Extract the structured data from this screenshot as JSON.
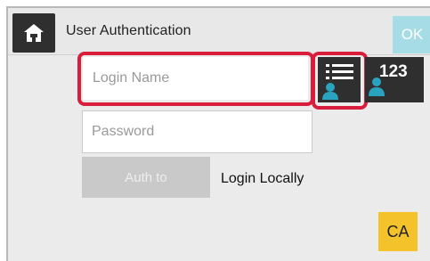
{
  "header": {
    "title": "User Authentication",
    "ok_label": "OK",
    "home_icon": "home-icon"
  },
  "form": {
    "login_name_placeholder": "Login Name",
    "password_placeholder": "Password",
    "auth_to_label": "Auth to",
    "login_locally_label": "Login Locally"
  },
  "side_buttons": {
    "user_list_icon": "user-list-icon",
    "user_number_label": "123",
    "user_number_icon": "user-icon"
  },
  "footer": {
    "ca_label": "CA"
  },
  "colors": {
    "highlight": "#d91e3c",
    "dark_button": "#2f2f2f",
    "ok_button": "#a6dce6",
    "ca_button": "#f4c32b",
    "user_icon": "#2aa3c0"
  }
}
